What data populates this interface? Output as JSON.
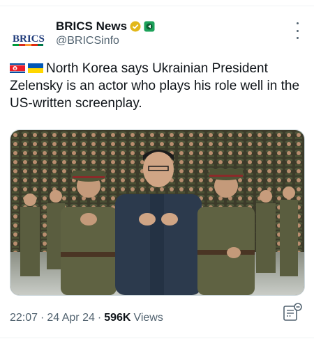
{
  "account": {
    "display_name": "BRICS News",
    "handle": "@BRICSinfo",
    "avatar_text": "BRICS",
    "verified_badge": "gold-check-icon",
    "affiliate_badge": "green-badge-icon"
  },
  "tweet": {
    "flags": [
      "north-korea-flag-icon",
      "ukraine-flag-icon"
    ],
    "text": "North Korea says Ukrainian President Zelensky is an actor who plays his role well in the US-written screenplay.",
    "media_icon": "photo"
  },
  "meta": {
    "time": "22:07",
    "sep1": "·",
    "date": "24 Apr 24",
    "sep2": "·",
    "views_count": "596K",
    "views_label": "Views"
  },
  "colors": {
    "text": "#0f1419",
    "secondary": "#536471",
    "gold": "#e2b719",
    "green": "#1da25a"
  }
}
